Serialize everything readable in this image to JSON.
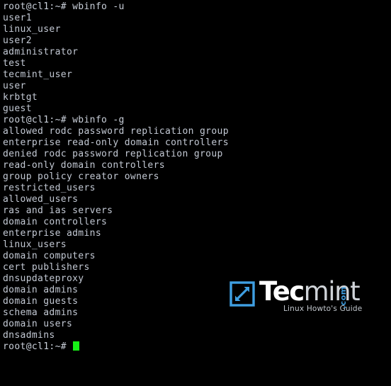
{
  "terminal": {
    "prompt": "root@cl1:~#",
    "cursor": "block-cursor",
    "foreground_color": "#c3c9d4",
    "background_color": "#000000",
    "cursor_color": "#16f016",
    "lines": [
      {
        "type": "command",
        "text": "root@cl1:~# wbinfo -u"
      },
      {
        "type": "output",
        "text": "user1"
      },
      {
        "type": "output",
        "text": "linux_user"
      },
      {
        "type": "output",
        "text": "user2"
      },
      {
        "type": "output",
        "text": "administrator"
      },
      {
        "type": "output",
        "text": "test"
      },
      {
        "type": "output",
        "text": "tecmint_user"
      },
      {
        "type": "output",
        "text": "user"
      },
      {
        "type": "output",
        "text": "krbtgt"
      },
      {
        "type": "output",
        "text": "guest"
      },
      {
        "type": "command",
        "text": "root@cl1:~# wbinfo -g"
      },
      {
        "type": "output",
        "text": "allowed rodc password replication group"
      },
      {
        "type": "output",
        "text": "enterprise read-only domain controllers"
      },
      {
        "type": "output",
        "text": "denied rodc password replication group"
      },
      {
        "type": "output",
        "text": "read-only domain controllers"
      },
      {
        "type": "output",
        "text": "group policy creator owners"
      },
      {
        "type": "output",
        "text": "restricted_users"
      },
      {
        "type": "output",
        "text": "allowed_users"
      },
      {
        "type": "output",
        "text": "ras and ias servers"
      },
      {
        "type": "output",
        "text": "domain controllers"
      },
      {
        "type": "output",
        "text": "enterprise admins"
      },
      {
        "type": "output",
        "text": "linux_users"
      },
      {
        "type": "output",
        "text": "domain computers"
      },
      {
        "type": "output",
        "text": "cert publishers"
      },
      {
        "type": "output",
        "text": "dnsupdateproxy"
      },
      {
        "type": "output",
        "text": "domain admins"
      },
      {
        "type": "output",
        "text": "domain guests"
      },
      {
        "type": "output",
        "text": "schema admins"
      },
      {
        "type": "output",
        "text": "domain users"
      },
      {
        "type": "output",
        "text": "dnsadmins"
      }
    ],
    "final_prompt": "root@cl1:~# "
  },
  "watermark": {
    "brand_primary": "Tec",
    "brand_secondary": "mint",
    "brand_tld": ".com",
    "tagline": "Linux Howto's Guide",
    "mark_color": "#3f9fe2",
    "primary_color": "#ffffff",
    "secondary_color": "#cfd3d8"
  }
}
